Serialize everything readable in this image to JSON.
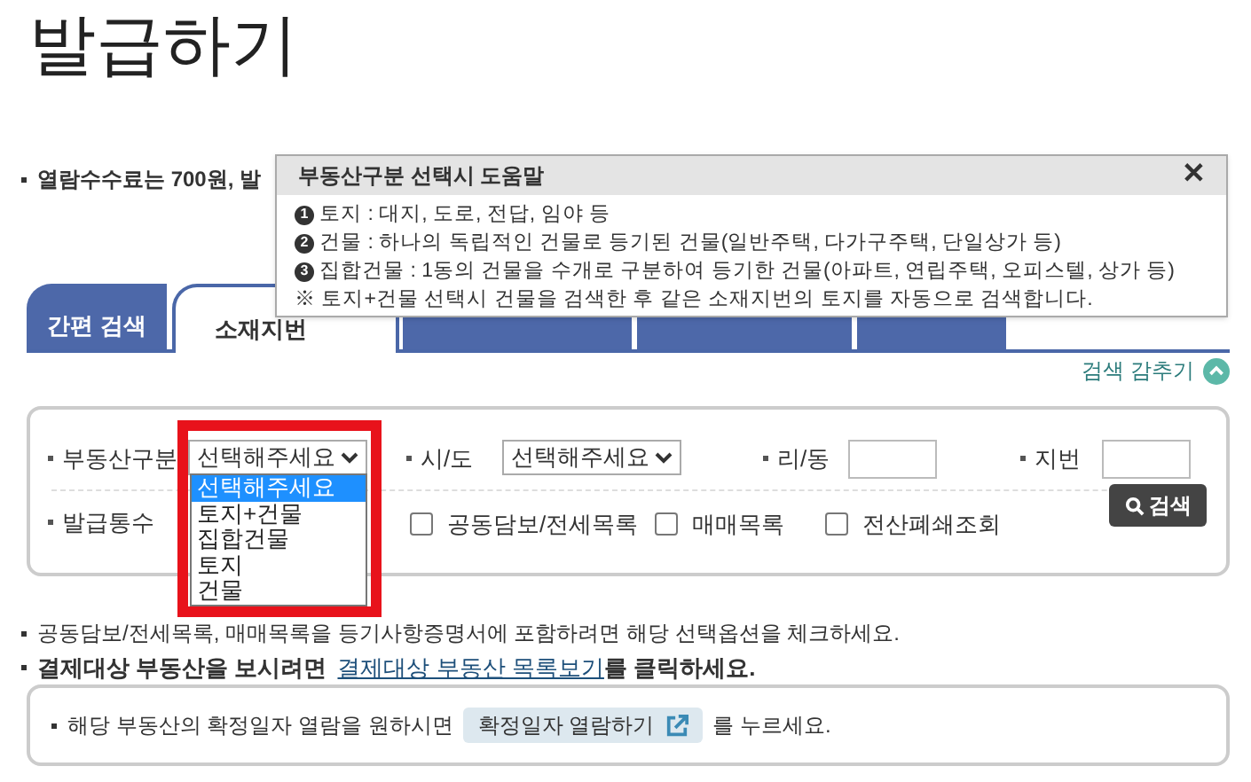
{
  "title": "발급하기",
  "fee_note": "열람수수료는 700원, 발",
  "help_popup": {
    "title": "부동산구분 선택시 도움말",
    "close": "✕",
    "items": [
      {
        "number": "1",
        "text": "토지 : 대지, 도로, 전답, 임야 등"
      },
      {
        "number": "2",
        "text": "건물 : 하나의 독립적인 건물로 등기된 건물(일반주택, 다가구주택, 단일상가 등)"
      },
      {
        "number": "3",
        "text": "집합건물 : 1동의 건물을 수개로 구분하여 등기한 건물(아파트, 연립주택, 오피스텔, 상가 등)"
      }
    ],
    "footnote": "※ 토지+건물 선택시 건물을 검색한 후 같은 소재지번의 토지를 자동으로 검색합니다."
  },
  "tabs": [
    {
      "label": "간편 검색",
      "selected": false
    },
    {
      "label": "소재지번",
      "selected": true
    },
    {
      "selected": false
    },
    {
      "selected": false
    },
    {
      "selected": false
    }
  ],
  "hide_search": "검색 감추기",
  "search": {
    "property_type": {
      "label": "부동산구분",
      "value": "선택해주세요",
      "expanded": true,
      "options": [
        {
          "label": "선택해주세요",
          "selected": true
        },
        {
          "label": "토지+건물",
          "selected": false
        },
        {
          "label": "집합건물",
          "selected": false
        },
        {
          "label": "토지",
          "selected": false
        },
        {
          "label": "건물",
          "selected": false
        }
      ]
    },
    "province": {
      "label": "시/도",
      "value": "선택해주세요"
    },
    "village": {
      "label": "리/동"
    },
    "lot": {
      "label": "지번"
    },
    "copies": {
      "label": "발급통수"
    },
    "checkboxes": [
      {
        "label": "공동담보/전세목록",
        "checked": false
      },
      {
        "label": "매매목록",
        "checked": false
      },
      {
        "label": "전산폐쇄조회",
        "checked": false
      }
    ],
    "button": "검색"
  },
  "notes": [
    {
      "text": "공동담보/전세목록, 매매목록을 등기사항증명서에 포함하려면 해당 선택옵션을 체크하세요."
    },
    {
      "text_bold": "결제대상 부동산을 보시려면",
      "link": "결제대상 부동산 목록보기",
      "text_after": "를 클릭하세요."
    }
  ],
  "date_box": {
    "before": "해당 부동산의 확정일자 열람을 원하시면",
    "button": "확정일자 열람하기",
    "after": "를 누르세요."
  }
}
